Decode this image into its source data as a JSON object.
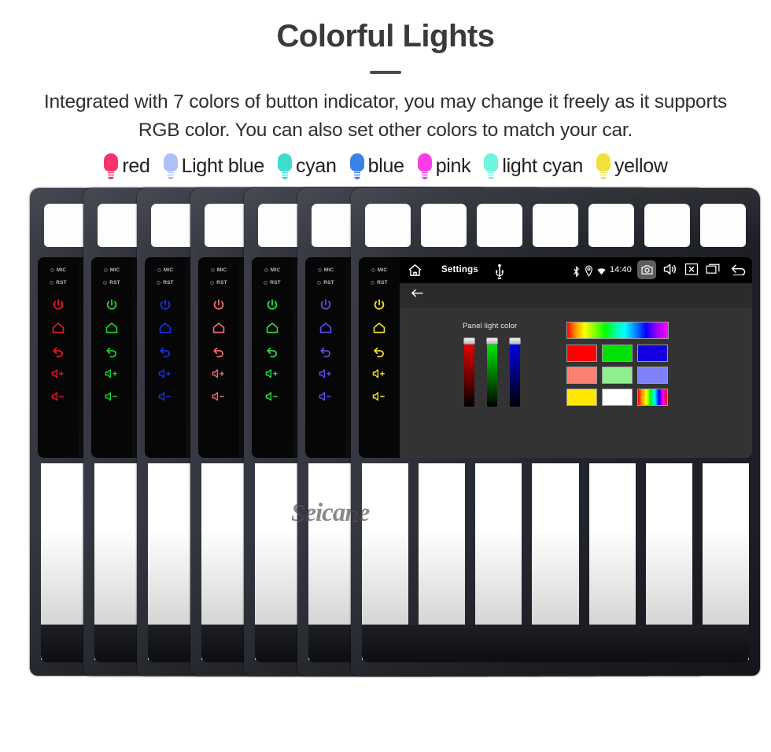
{
  "header": {
    "title": "Colorful Lights",
    "subtitle": "Integrated with 7 colors of button indicator, you may change it freely as it supports RGB color. You can also set other colors to match your car."
  },
  "legend": {
    "items": [
      {
        "label": "red",
        "color": "#f8326a",
        "icon": "bulb-icon"
      },
      {
        "label": "Light blue",
        "color": "#afc0f7",
        "icon": "bulb-icon"
      },
      {
        "label": "cyan",
        "color": "#3fdbcf",
        "icon": "bulb-icon"
      },
      {
        "label": "blue",
        "color": "#3b82e8",
        "icon": "bulb-icon"
      },
      {
        "label": "pink",
        "color": "#f93ee8",
        "icon": "bulb-icon"
      },
      {
        "label": "light cyan",
        "color": "#6ef5df",
        "icon": "bulb-icon"
      },
      {
        "label": "yellow",
        "color": "#f2e03c",
        "icon": "bulb-icon"
      }
    ]
  },
  "units": {
    "count": 7,
    "button_colors": [
      "#e8172a",
      "#18d62a",
      "#1730e8",
      "#f06a72",
      "#2ade46",
      "#5a4df0",
      "#f2e22e"
    ],
    "strip_labels": {
      "mic": "MIC",
      "rst": "RST"
    },
    "key_icons": [
      "power-icon",
      "home-icon",
      "back-icon",
      "volume-up-icon",
      "volume-down-icon"
    ]
  },
  "android": {
    "statusbar": {
      "home_icon": "home-icon",
      "title": "Settings",
      "usb_icon": "usb-icon",
      "bluetooth_icon": "bluetooth-icon",
      "location_icon": "location-pin-icon",
      "wifi_icon": "wifi-icon",
      "time": "14:40",
      "camera_icon": "camera-icon",
      "volume_icon": "speaker-icon",
      "close_icon": "close-box-icon",
      "recents_icon": "recents-icon",
      "back_icon": "back-arrow-icon"
    },
    "toolbar": {
      "back_icon": "arrow-left-icon"
    },
    "settings": {
      "panel_label": "Panel light color",
      "sliders": [
        {
          "name": "red-slider",
          "color": "#ff0000",
          "value": 100
        },
        {
          "name": "green-slider",
          "color": "#00ff00",
          "value": 100
        },
        {
          "name": "blue-slider",
          "color": "#0000ff",
          "value": 100
        }
      ],
      "swatches": [
        "#ff0000",
        "#00e000",
        "#1400e0",
        "#fa8072",
        "#90ee90",
        "#8080f8",
        "#ffe800",
        "#ffffff",
        "rainbow"
      ]
    }
  },
  "watermark": {
    "text": "Seicane"
  }
}
